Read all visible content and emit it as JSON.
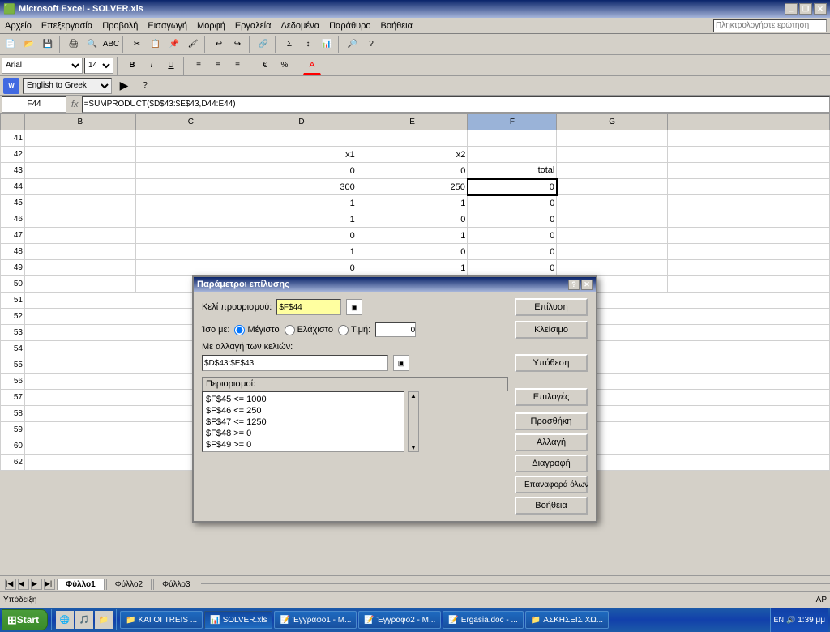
{
  "window": {
    "title": "Microsoft Excel - SOLVER.xls",
    "icon": "excel-icon"
  },
  "menu": {
    "items": [
      "Αρχείο",
      "Επεξεργασία",
      "Προβολή",
      "Εισαγωγή",
      "Μορφή",
      "Εργαλεία",
      "Δεδομένα",
      "Παράθυρο",
      "Βοήθεια"
    ]
  },
  "search": {
    "placeholder": "Πληκτρολογήστε ερώτηση"
  },
  "translate": {
    "label": "English to Greek",
    "options": [
      "English to Greek"
    ]
  },
  "formula_bar": {
    "cell_ref": "F44",
    "formula": "=SUMPRODUCT($D$43:$E$43,D44:E44)"
  },
  "font": {
    "name": "Arial",
    "size": "14"
  },
  "columns": [
    "B",
    "C",
    "D",
    "E",
    "F",
    "G"
  ],
  "rows": {
    "41": {
      "b": "",
      "c": "",
      "d": "",
      "e": "",
      "f": "",
      "g": ""
    },
    "42": {
      "b": "",
      "c": "",
      "d": "x1",
      "e": "x2",
      "f": "",
      "g": ""
    },
    "43": {
      "b": "",
      "c": "",
      "d": "0",
      "e": "0",
      "f": "total",
      "g": ""
    },
    "44": {
      "b": "",
      "c": "",
      "d": "300",
      "e": "250",
      "f": "0",
      "g": ""
    },
    "45": {
      "b": "",
      "c": "",
      "d": "1",
      "e": "1",
      "f": "0",
      "g": ""
    },
    "46": {
      "b": "",
      "c": "",
      "d": "1",
      "e": "0",
      "f": "0",
      "g": ""
    },
    "47": {
      "b": "",
      "c": "",
      "d": "0",
      "e": "1",
      "f": "0",
      "g": ""
    },
    "48": {
      "b": "",
      "c": "",
      "d": "1",
      "e": "0",
      "f": "0",
      "g": ""
    },
    "49": {
      "b": "",
      "c": "",
      "d": "0",
      "e": "1",
      "f": "0",
      "g": ""
    },
    "50": {
      "b": "",
      "c": "",
      "d": "",
      "e": "",
      "f": "",
      "g": ""
    },
    "51": {
      "b": "",
      "c": "",
      "d": "",
      "e": "",
      "f": "",
      "g": ""
    },
    "52": {
      "b": "",
      "c": "",
      "d": "",
      "e": "",
      "f": "",
      "g": ""
    },
    "53": {
      "b": "",
      "c": "",
      "d": "",
      "e": "",
      "f": "",
      "g": ""
    },
    "54": {
      "b": "",
      "c": "",
      "d": "",
      "e": "",
      "f": "",
      "g": ""
    },
    "55": {
      "b": "",
      "c": "",
      "d": "",
      "e": "",
      "f": "",
      "g": ""
    },
    "56": {
      "b": "",
      "c": "",
      "d": "",
      "e": "",
      "f": "",
      "g": ""
    },
    "57": {
      "b": "",
      "c": "",
      "d": "",
      "e": "",
      "f": "",
      "g": ""
    },
    "58": {
      "b": "",
      "c": "",
      "d": "",
      "e": "",
      "f": "",
      "g": ""
    },
    "59": {
      "b": "",
      "c": "",
      "d": "",
      "e": "",
      "f": "",
      "g": ""
    },
    "60": {
      "b": "",
      "c": "",
      "d": "",
      "e": "",
      "f": "",
      "g": ""
    }
  },
  "sheet_tabs": [
    "Φύλλο1",
    "Φύλλο2",
    "Φύλλο3"
  ],
  "active_tab": "Φύλλο1",
  "status": {
    "left": "Υπόδειξη",
    "right": "AP"
  },
  "dialog": {
    "title": "Παράμετροι επίλυσης",
    "cell_ref_label": "Κελί προορισμού:",
    "cell_ref_value": "$F$44",
    "iso_me_label": "Ίσο με:",
    "megisto_label": "Μέγιστο",
    "elaxisto_label": "Ελάχιστο",
    "timi_label": "Τιμή:",
    "timi_value": "0",
    "allaxi_label": "Με αλλαγή των κελιών:",
    "allaxi_value": "$D$43:$E$43",
    "perio_label": "Περιορισμοί:",
    "constraints": [
      "$F$45 <= 1000",
      "$F$46 <= 250",
      "$F$47 <= 1250",
      "$F$48 >= 0",
      "$F$49 >= 0"
    ],
    "btn_epilysi": "Επίλυση",
    "btn_kleisimo": "Κλείσιμο",
    "btn_ypothesi": "Υπόθεση",
    "btn_epiloges": "Επιλογές",
    "btn_prosthiki": "Προσθήκη",
    "btn_allagi": "Αλλαγή",
    "btn_diagrafi": "Διαγραφή",
    "btn_epanafora": "Επαναφορά όλων",
    "btn_voitheia": "Βοήθεια"
  },
  "taskbar": {
    "start_label": "Start",
    "items": [
      {
        "label": "KAI OI TREIS ...",
        "icon": "folder-icon",
        "active": false
      },
      {
        "label": "SOLVER.xls",
        "icon": "excel-icon",
        "active": true
      },
      {
        "label": "Έγγραφο1 - M...",
        "icon": "word-icon",
        "active": false
      },
      {
        "label": "Έγγραφο2 - M...",
        "icon": "word-icon",
        "active": false
      },
      {
        "label": "Ergasia.doc - ...",
        "icon": "word-icon",
        "active": false
      },
      {
        "label": "ΑΣΚΗΣΕΙΣ ΧΩ...",
        "icon": "folder-icon",
        "active": false
      }
    ],
    "time": "1:39 μμ"
  }
}
